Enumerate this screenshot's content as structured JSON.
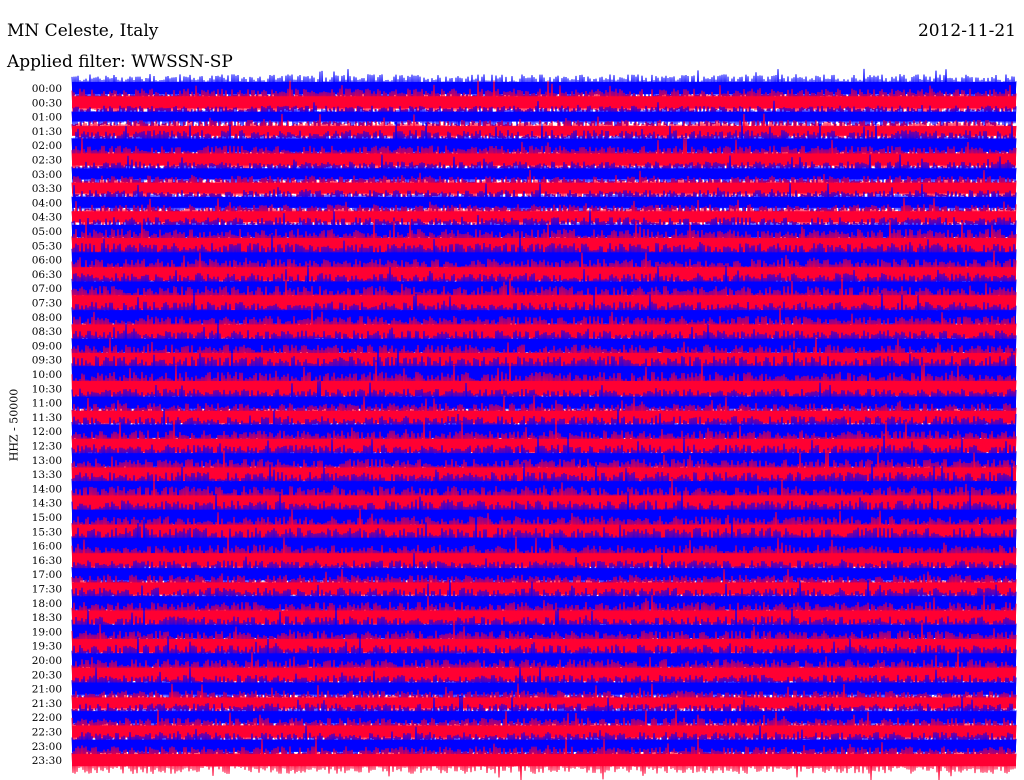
{
  "header": {
    "station": "MN Celeste, Italy",
    "date": "2012-11-21",
    "filter": "Applied filter: WWSSN-SP"
  },
  "colors": {
    "trace_a": "#0000ff",
    "trace_b": "#ff0033",
    "background": "#ffffff"
  },
  "chart_data": {
    "type": "line",
    "title": "MN Celeste, Italy",
    "subtitle": "Applied filter: WWSSN-SP",
    "date": "2012-11-21",
    "ylabel": "HHZ - 50000",
    "xlabel": "",
    "row_interval_minutes": 30,
    "row_labels": [
      "00:00",
      "00:30",
      "01:00",
      "01:30",
      "02:00",
      "02:30",
      "03:00",
      "03:30",
      "04:00",
      "04:30",
      "05:00",
      "05:30",
      "06:00",
      "06:30",
      "07:00",
      "07:30",
      "08:00",
      "08:30",
      "09:00",
      "09:30",
      "10:00",
      "10:30",
      "11:00",
      "11:30",
      "12:00",
      "12:30",
      "13:00",
      "13:30",
      "14:00",
      "14:30",
      "15:00",
      "15:30",
      "16:00",
      "16:30",
      "17:00",
      "17:30",
      "18:00",
      "18:30",
      "19:00",
      "19:30",
      "20:00",
      "20:30",
      "21:00",
      "21:30",
      "22:00",
      "22:30",
      "23:00",
      "23:30"
    ],
    "series": [
      {
        "color": "#0000ff",
        "rows": "even (00:00, 01:00, 02:00, ...)"
      },
      {
        "color": "#ff0033",
        "rows": "odd (00:30, 01:30, 02:30, ...)"
      }
    ],
    "relative_amplitude": [
      1.0,
      1.0,
      0.8,
      0.8,
      1.1,
      1.0,
      0.9,
      0.9,
      0.9,
      0.9,
      1.0,
      1.2,
      1.2,
      1.1,
      1.1,
      1.2,
      1.1,
      1.1,
      1.1,
      1.1,
      1.3,
      1.2,
      1.0,
      1.0,
      1.1,
      1.1,
      1.1,
      1.1,
      1.2,
      1.2,
      1.2,
      1.1,
      1.3,
      1.1,
      1.0,
      1.0,
      1.1,
      1.1,
      1.1,
      1.1,
      1.1,
      1.1,
      1.0,
      0.9,
      1.0,
      1.0,
      1.0,
      1.0
    ],
    "grid": false,
    "legend": "none"
  }
}
